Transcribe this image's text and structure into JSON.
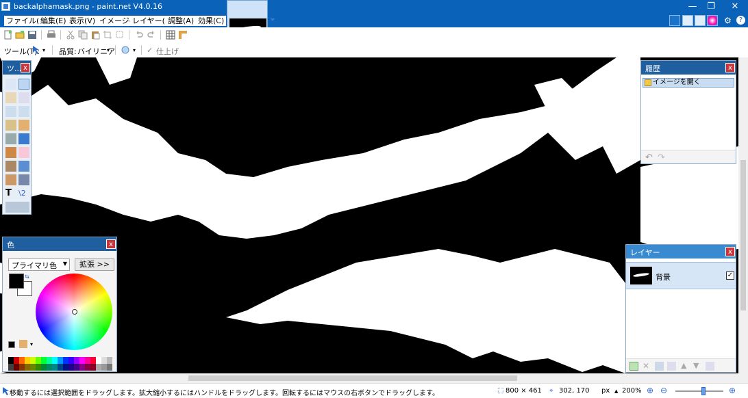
{
  "window": {
    "title": "backalphamask.png - paint.net V4.0.16",
    "restore_glyph": "❐",
    "minimize_glyph": "—",
    "close_glyph": "✕"
  },
  "menu": {
    "items": [
      "ファイル(F)",
      "編集(E)",
      "表示(V)",
      "イメージ(I)",
      "レイヤー(L)",
      "調整(A)",
      "効果(C)"
    ]
  },
  "toolbar2": {
    "tool_label": "ツール(T):",
    "quality_label": "品質:",
    "quality_value": "バイリニア",
    "finish_label": "仕上げ"
  },
  "tools_panel": {
    "title": "ツ...",
    "close": "x"
  },
  "colors_panel": {
    "title": "色",
    "close": "x",
    "select_value": "プライマリ色",
    "expand_button": "拡張 >>"
  },
  "history_panel": {
    "title": "履歴",
    "close": "x",
    "items": [
      "イメージを開く"
    ]
  },
  "layers_panel": {
    "title": "レイヤー",
    "close": "x",
    "layers": [
      {
        "name": "背景",
        "visible": true
      }
    ]
  },
  "status": {
    "message": "移動するには選択範囲をドラッグします。拡大縮小するにはハンドルをドラッグします。回転するにはマウスの右ボタンでドラッグします。",
    "image_size": "800 × 461",
    "cursor_pos": "302, 170",
    "unit": "px",
    "zoom": "200%"
  },
  "colors": {
    "titlebar": "#0a63b8",
    "panel_header": "#1f5e9f",
    "close_button": "#c8353b"
  },
  "icons": [
    "app-icon",
    "new-icon",
    "open-icon",
    "save-icon",
    "print-icon",
    "cut-icon",
    "copy-icon",
    "paste-icon",
    "crop-icon",
    "deselect-icon",
    "undo-icon",
    "redo-icon",
    "grid-icon",
    "ruler-icon",
    "settings-icon",
    "help-icon"
  ]
}
